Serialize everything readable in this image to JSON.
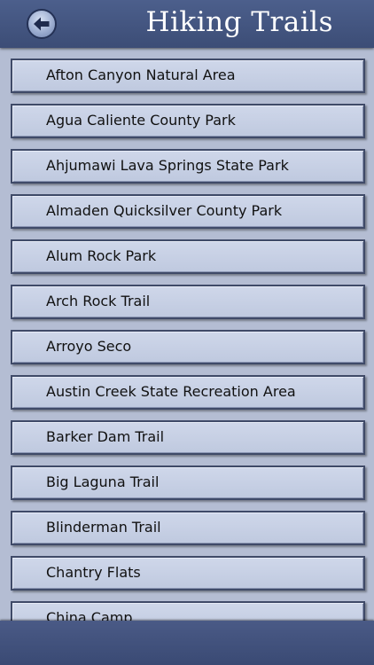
{
  "header": {
    "title": "Hiking Trails",
    "back_icon": "back-arrow-icon"
  },
  "colors": {
    "header_bg": "#44557f",
    "list_bg": "#b4bdd3",
    "item_bg": "#c8d0e5",
    "item_border": "#3f4a68",
    "footer_bg": "#42527c"
  },
  "trails": [
    {
      "label": "Afton Canyon Natural Area"
    },
    {
      "label": "Agua Caliente County Park"
    },
    {
      "label": "Ahjumawi Lava Springs State Park"
    },
    {
      "label": "Almaden Quicksilver County Park"
    },
    {
      "label": "Alum Rock Park"
    },
    {
      "label": "Arch Rock Trail"
    },
    {
      "label": "Arroyo Seco"
    },
    {
      "label": "Austin Creek State Recreation Area"
    },
    {
      "label": "Barker Dam Trail"
    },
    {
      "label": "Big Laguna Trail"
    },
    {
      "label": "Blinderman Trail"
    },
    {
      "label": "Chantry Flats"
    },
    {
      "label": "China Camp"
    }
  ]
}
